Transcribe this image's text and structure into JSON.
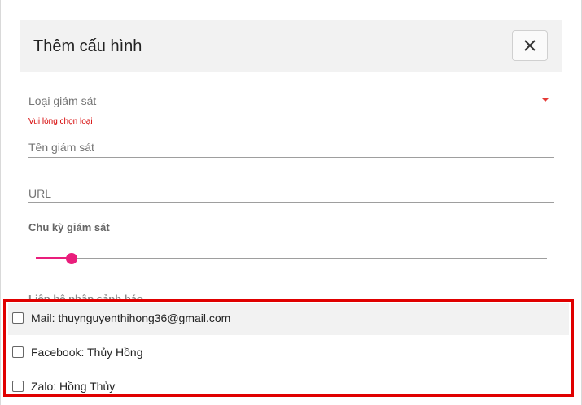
{
  "dialog": {
    "title": "Thêm cấu hình",
    "close_icon": "close-icon"
  },
  "form": {
    "monitor_type": {
      "label": "Loại giám sát",
      "error": "Vui lòng chọn loại",
      "error_color": "#d50000"
    },
    "monitor_name": {
      "label": "Tên giám sát"
    },
    "url": {
      "label": "URL"
    },
    "interval": {
      "label": "Chu kỳ giám sát",
      "slider_value_fraction": 0.07,
      "accent": "#e91e7c"
    },
    "contacts": {
      "label": "Liên hệ nhận cảnh báo",
      "items": [
        {
          "label": "Mail: thuynguyenthihong36@gmail.com",
          "checked": false
        },
        {
          "label": "Facebook: Thủy Hồng",
          "checked": false
        },
        {
          "label": "Zalo: Hồng Thủy",
          "checked": false
        }
      ]
    }
  }
}
